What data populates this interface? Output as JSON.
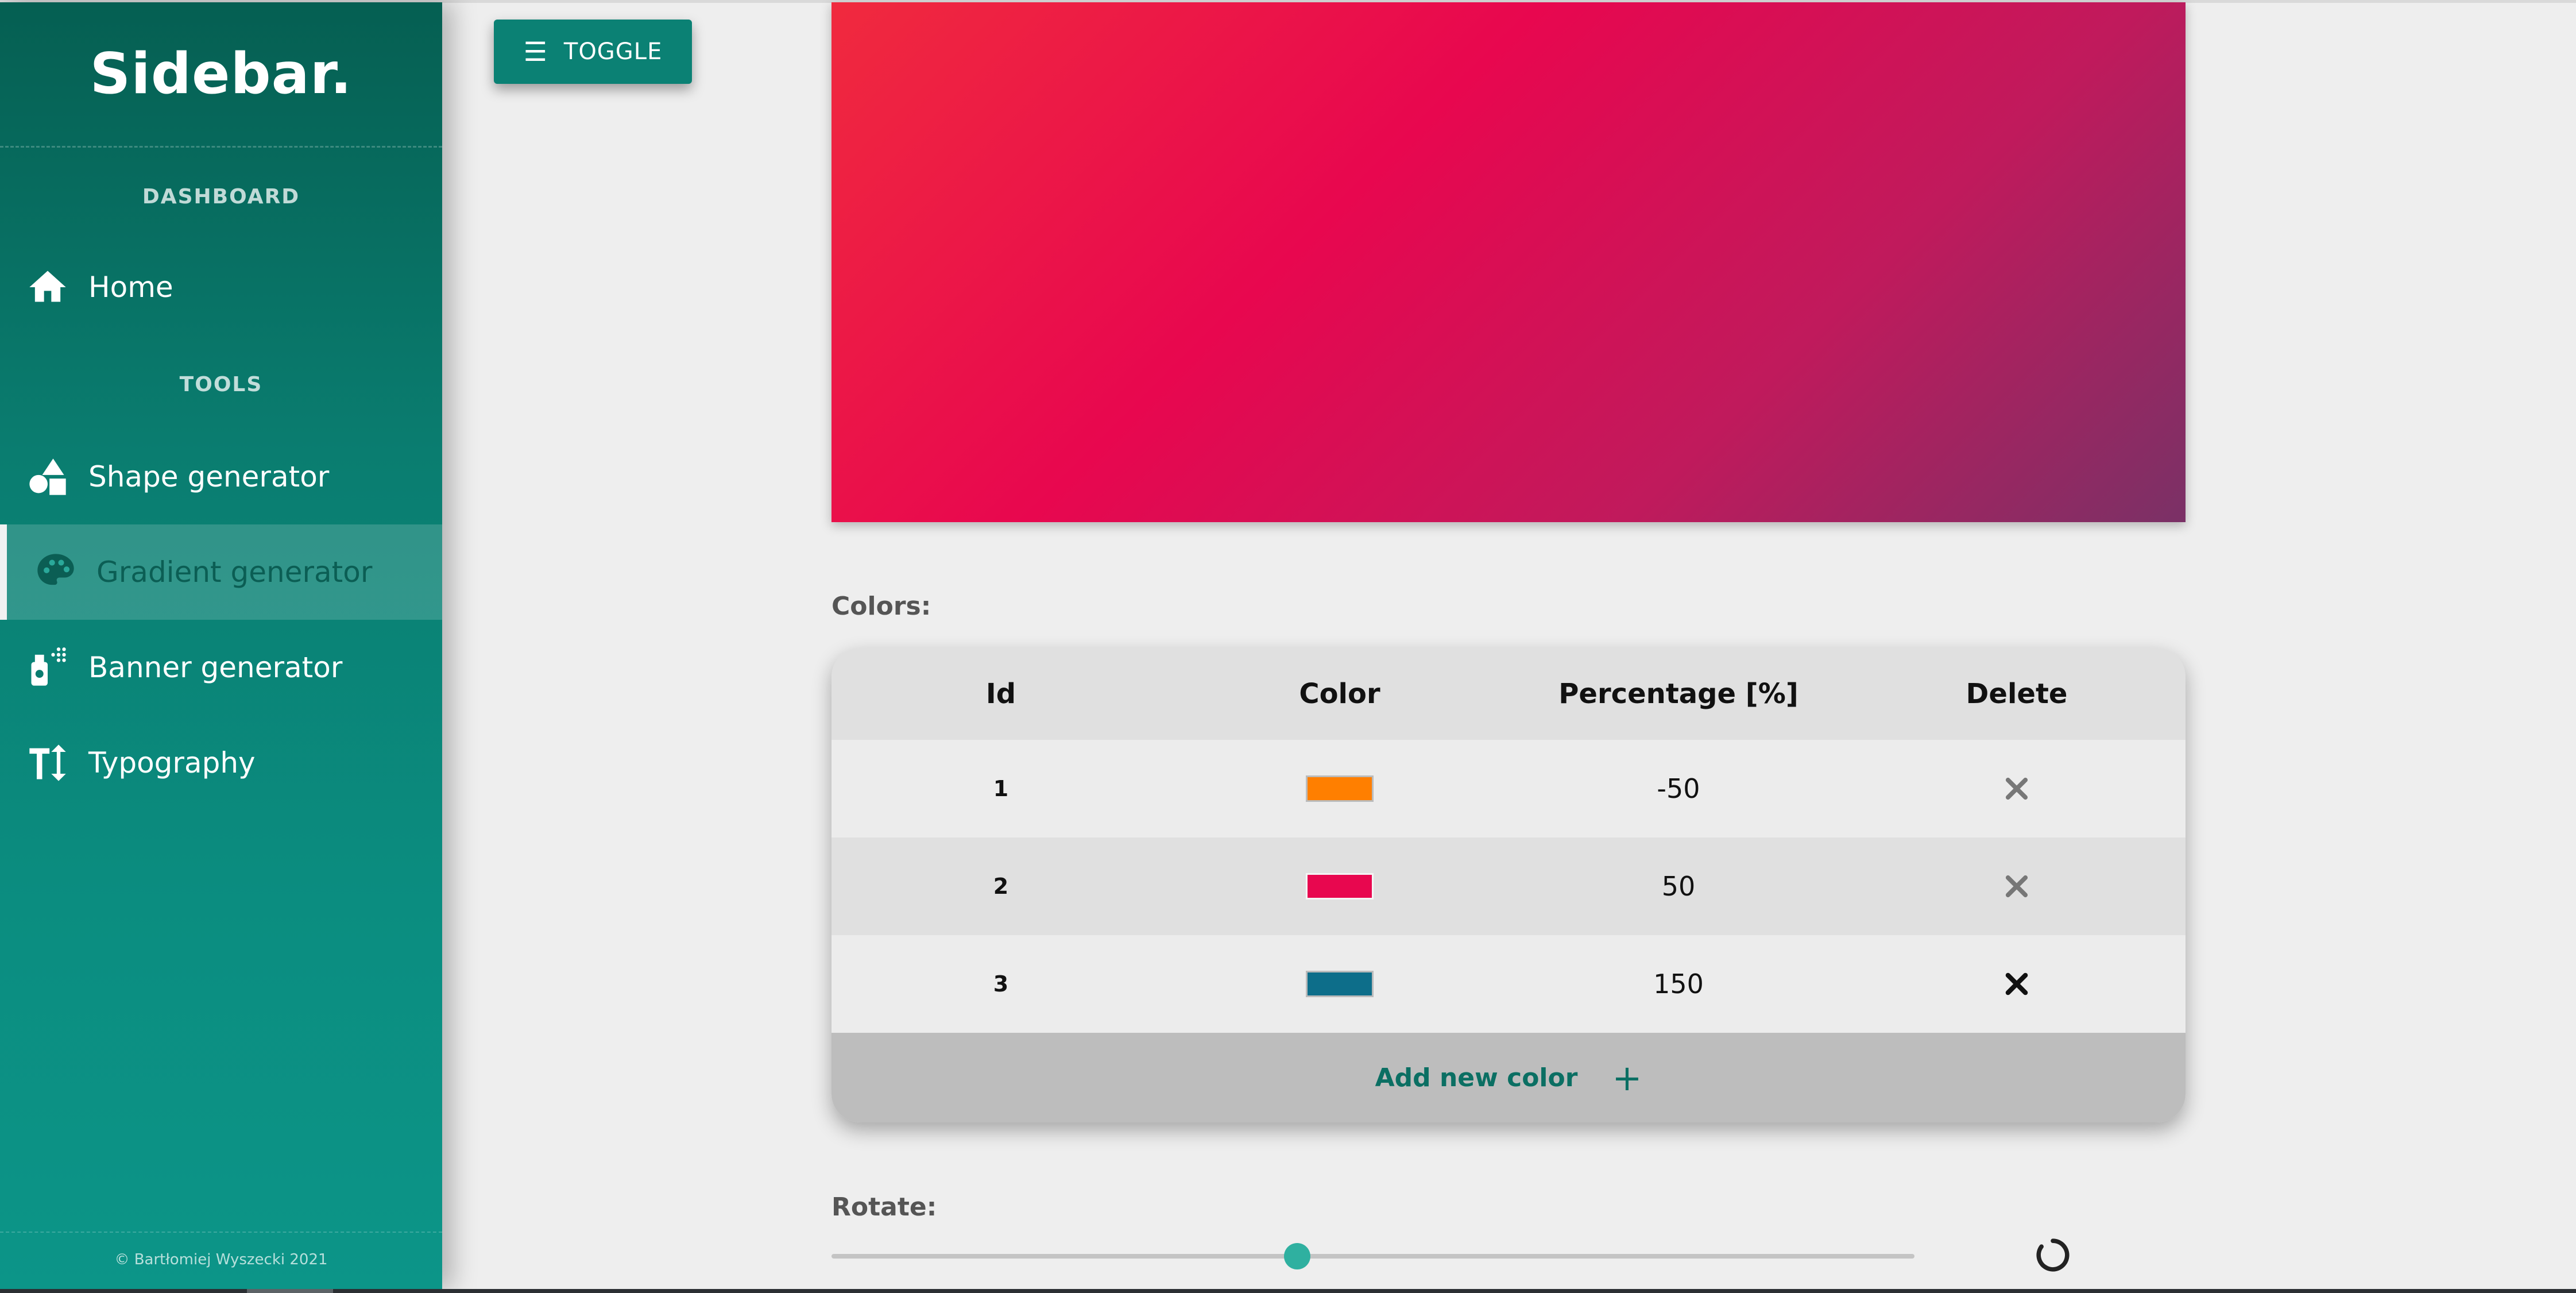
{
  "sidebar": {
    "brand": "Sidebar.",
    "sections": [
      "DASHBOARD",
      "TOOLS"
    ],
    "items": [
      {
        "label": "Home",
        "icon": "home-icon"
      },
      {
        "label": "Shape generator",
        "icon": "shapes-icon"
      },
      {
        "label": "Gradient generator",
        "icon": "palette-icon",
        "active": true
      },
      {
        "label": "Banner generator",
        "icon": "spray-can-icon"
      },
      {
        "label": "Typography",
        "icon": "text-height-icon"
      }
    ],
    "copyright": "© Bartłomiej Wyszecki 2021"
  },
  "toolbar": {
    "toggle_label": "TOGGLE"
  },
  "colors_label": "Colors:",
  "table": {
    "headers": [
      "Id",
      "Color",
      "Percentage [%]",
      "Delete"
    ],
    "rows": [
      {
        "id": "1",
        "color": "#ff7f00",
        "percentage": "-50"
      },
      {
        "id": "2",
        "color": "#e8074f",
        "percentage": "50"
      },
      {
        "id": "3",
        "color": "#0d6e8a",
        "percentage": "150"
      }
    ],
    "add_label": "Add new color",
    "add_symbol": "+"
  },
  "rotate_label": "Rotate:",
  "rotate_slider": {
    "value_fraction": 0.43
  },
  "colors": {
    "accent": "#0b8174",
    "sidebar": "#0a7d70"
  }
}
